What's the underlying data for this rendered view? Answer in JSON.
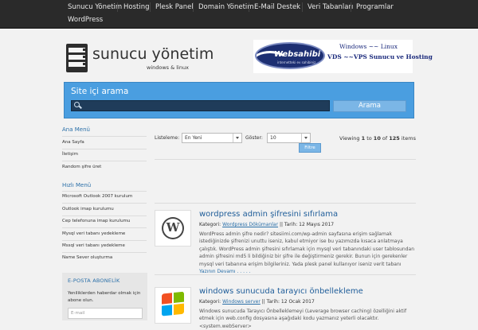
{
  "nav": {
    "items": [
      "Sunucu Yönetim",
      "Hosting",
      "Plesk Panel",
      "Domain Yönetim",
      "E-Mail Destek",
      "Veri Tabanları",
      "Programlar",
      "WordPress"
    ]
  },
  "header": {
    "site_title": "sunucu yönetim",
    "tagline": "windows & linux",
    "icon": "server-icon"
  },
  "banner": {
    "brand": "Websahibi",
    "brand_sub": "internetteki ev sahibiniz",
    "line1": "Windows ~~ Linux",
    "line2": "VDS ~~VPS Sunucu ve Hosting"
  },
  "search": {
    "label": "Site içi arama",
    "placeholder": "",
    "button": "Arama"
  },
  "sidebar": {
    "menu_title": "Ana Menü",
    "menu_items": [
      "Ana Sayfa",
      "İletişim",
      "Random şifre üret"
    ],
    "quick_title": "Hızlı Menü",
    "quick_items": [
      "Microsoft Outlook 2007 kurulum",
      "Outlook imap kurulumu",
      "Cep telefonuna imap kurulumu",
      "Mysql veri tabanı yedekleme",
      "Mssql veri tabanı yedekleme",
      "Name Sever oluşturma"
    ],
    "email": {
      "title": "E-POSTA ABONELİK",
      "text": "Yeniliklerden haberdar olmak için abone olun.",
      "placeholder": "E-mail"
    }
  },
  "filter": {
    "sort_label": "Listeleme:",
    "sort_value": "En Yeni",
    "show_label": "Göster:",
    "show_value": "10",
    "button": "Filtre",
    "viewing_prefix": "Viewing",
    "from": "1",
    "to_word": "to",
    "to": "10",
    "of_word": "of",
    "total": "125",
    "items_word": "items"
  },
  "posts": [
    {
      "title": "wordpress admin şifresini sıfırlama",
      "category_label": "Kategori:",
      "category": "Wordpress Dökümanlar",
      "date_label": "|| Tarih:",
      "date": "12 Mayıs 2017",
      "excerpt": "WordPress admin şifre nedir? sitesiimi.com/wp-admin sayfasına erişim sağlamak istediğinizde şifrenizi unuttu iseniz, kabul etmiyor ise bu yazımızda kısaca anlatmaya çalıştık. WordPress admin şifresini sıfırlamak için mysql veri tabanındaki user tablosundan admin şifresini md5 li bildiğiniz bir şifre ile değiştirmeniz gerekir. Bunun için gerekenler mysql veri tabanına erişim bilgileriniz. Yada plesk panel kullanıyor iseniz verit tabanı",
      "more": "Yazının Devamı . . . . .",
      "thumb_icon": "wordpress-logo-icon"
    },
    {
      "title": "windows sunucuda tarayıcı önbellekleme",
      "category_label": "Kategori:",
      "category": "Windows server",
      "date_label": "|| Tarih:",
      "date": "12 Ocak 2017",
      "excerpt": "Windows sunucuda Tarayıcı Önbelleklemeyi (Leverage browser caching) özelliğini aktif etmek için web.config dosyasına aşağıdaki kodu yazmanız yeterli olacaktır. <system.webServer>",
      "more": "",
      "thumb_icon": "windows-logo-icon"
    }
  ],
  "colors": {
    "nav_bg": "#2a2a2a",
    "accent": "#4a9ee0",
    "link": "#1f5d99"
  }
}
